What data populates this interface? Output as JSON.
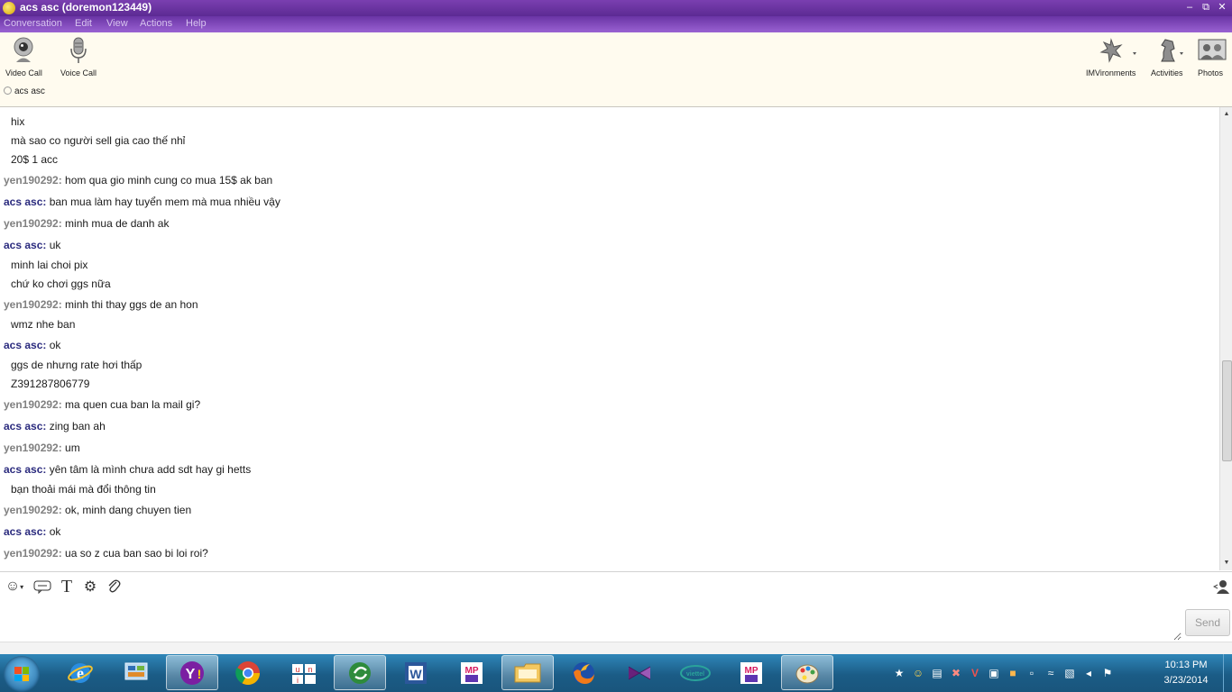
{
  "window": {
    "title": "acs asc (doremon123449)",
    "controls": [
      "minimize-icon",
      "restore-icon",
      "close-icon"
    ]
  },
  "menu": [
    "Conversation",
    "Edit",
    "View",
    "Actions",
    "Help"
  ],
  "toolbar": {
    "left": [
      {
        "label": "Video Call",
        "icon": "webcam-icon"
      },
      {
        "label": "Voice Call",
        "icon": "microphone-icon"
      }
    ],
    "right": [
      {
        "label": "IMVironments",
        "icon": "imvironments-icon"
      },
      {
        "label": "Activities",
        "icon": "chess-knight-icon"
      },
      {
        "label": "Photos",
        "icon": "photos-icon"
      }
    ]
  },
  "contact": {
    "name": "acs asc",
    "status_icon": "offline-status-icon"
  },
  "chat": [
    {
      "user": "",
      "text": "hix"
    },
    {
      "user": "",
      "text": "mà sao co người sell gia cao thế nhỉ"
    },
    {
      "user": "",
      "text": "20$ 1 acc"
    },
    {
      "user": "yen190292:",
      "text": " hom qua gio minh cung co mua 15$ ak ban"
    },
    {
      "user": "acs asc:",
      "text": " ban mua làm hay tuyển mem mà mua nhiều vậy"
    },
    {
      "user": "yen190292:",
      "text": " minh mua de danh ak"
    },
    {
      "user": "acs asc:",
      "text": " uk"
    },
    {
      "user": "",
      "text": "minh lai choi pix"
    },
    {
      "user": "",
      "text": "chứ ko chơi ggs nữa"
    },
    {
      "user": "yen190292:",
      "text": " minh thi thay ggs de an hon"
    },
    {
      "user": "",
      "text": "wmz nhe ban"
    },
    {
      "user": "acs asc:",
      "text": " ok"
    },
    {
      "user": "",
      "text": "ggs de nhưng rate hơi thấp"
    },
    {
      "user": "",
      "text": "Z391287806779"
    },
    {
      "user": "yen190292:",
      "text": " ma quen cua ban la mail gi?"
    },
    {
      "user": "acs asc:",
      "text": " zing ban ah"
    },
    {
      "user": "yen190292:",
      "text": " um"
    },
    {
      "user": "acs asc:",
      "text": " yên tâm là mình chưa add sdt hay gi hetts"
    },
    {
      "user": "",
      "text": "bạn thoải mái mà đổi thông tin"
    },
    {
      "user": "yen190292:",
      "text": " ok, minh dang chuyen tien"
    },
    {
      "user": "acs asc:",
      "text": " ok"
    },
    {
      "user": "yen190292:",
      "text": " ua so z cua ban sao bi loi roi?"
    }
  ],
  "format_bar": [
    "emoticon-icon",
    "audibles-icon",
    "text-format-icon",
    "settings-icon",
    "attachment-icon"
  ],
  "format_bar_right": "contact-list-icon",
  "input": {
    "value": "",
    "placeholder": ""
  },
  "send_label": "Send",
  "taskbar": {
    "apps": [
      "internet-explorer-icon",
      "control-panel-icon",
      "yahoo-messenger-icon",
      "chrome-icon",
      "unikey-icon",
      "coccoc-icon",
      "word-icon",
      "mp3-player-icon",
      "file-explorer-icon",
      "firefox-icon",
      "visual-studio-icon",
      "viettel-icon",
      "mp3-player-icon",
      "paint-icon"
    ],
    "tray": [
      "yahoo-tray-icon",
      "emoticon-tray-icon",
      "network-device-icon",
      "security-icon",
      "antivirus-icon",
      "ultraviewer-icon",
      "stickies-icon",
      "display-icon",
      "wifi-icon",
      "usb-icon",
      "volume-icon",
      "action-center-icon"
    ],
    "time": "10:13 PM",
    "date": "3/23/2014"
  },
  "colors": {
    "title_bar": "#6a34a5",
    "user_yen": "#808080",
    "user_acs": "#2b2b7e",
    "toolbar_bg": "#fffbef",
    "taskbar": "#1b5c86"
  }
}
